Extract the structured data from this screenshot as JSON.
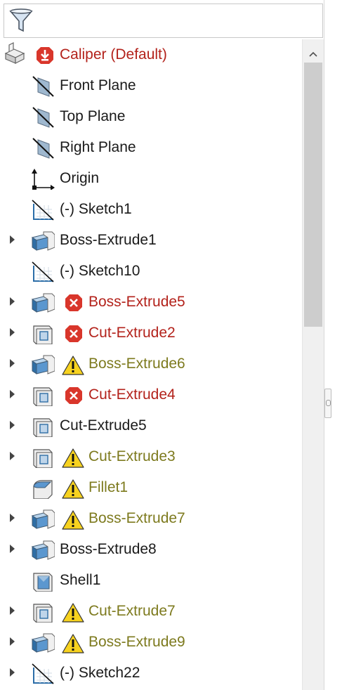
{
  "filter": {
    "icon": "filter-icon"
  },
  "root": {
    "label": "Caliper  (Default)",
    "icon": "part-icon",
    "status_icon": "rebuild-error-icon"
  },
  "items": [
    {
      "label": "Front Plane",
      "icon": "plane-icon",
      "expandable": false,
      "status": ""
    },
    {
      "label": "Top Plane",
      "icon": "plane-icon",
      "expandable": false,
      "status": ""
    },
    {
      "label": "Right Plane",
      "icon": "plane-icon",
      "expandable": false,
      "status": ""
    },
    {
      "label": "Origin",
      "icon": "origin-icon",
      "expandable": false,
      "status": ""
    },
    {
      "label": "(-) Sketch1",
      "icon": "sketch-icon",
      "expandable": false,
      "status": ""
    },
    {
      "label": "Boss-Extrude1",
      "icon": "boss-extrude-icon",
      "expandable": true,
      "status": ""
    },
    {
      "label": "(-) Sketch10",
      "icon": "sketch-icon",
      "expandable": false,
      "status": ""
    },
    {
      "label": "Boss-Extrude5",
      "icon": "boss-extrude-icon",
      "expandable": true,
      "status": "error"
    },
    {
      "label": "Cut-Extrude2",
      "icon": "cut-extrude-icon",
      "expandable": true,
      "status": "error"
    },
    {
      "label": "Boss-Extrude6",
      "icon": "boss-extrude-icon",
      "expandable": true,
      "status": "warning"
    },
    {
      "label": "Cut-Extrude4",
      "icon": "cut-extrude-icon",
      "expandable": true,
      "status": "error"
    },
    {
      "label": "Cut-Extrude5",
      "icon": "cut-extrude-icon",
      "expandable": true,
      "status": ""
    },
    {
      "label": "Cut-Extrude3",
      "icon": "cut-extrude-icon",
      "expandable": true,
      "status": "warning"
    },
    {
      "label": "Fillet1",
      "icon": "fillet-icon",
      "expandable": false,
      "status": "warning"
    },
    {
      "label": "Boss-Extrude7",
      "icon": "boss-extrude-icon",
      "expandable": true,
      "status": "warning"
    },
    {
      "label": "Boss-Extrude8",
      "icon": "boss-extrude-icon",
      "expandable": true,
      "status": ""
    },
    {
      "label": "Shell1",
      "icon": "shell-icon",
      "expandable": false,
      "status": ""
    },
    {
      "label": "Cut-Extrude7",
      "icon": "cut-extrude-icon",
      "expandable": true,
      "status": "warning"
    },
    {
      "label": "Boss-Extrude9",
      "icon": "boss-extrude-icon",
      "expandable": true,
      "status": "warning"
    },
    {
      "label": "(-) Sketch22",
      "icon": "sketch-icon",
      "expandable": true,
      "status": ""
    }
  ],
  "colors": {
    "error_text": "#b3221b",
    "warning_text": "#7d7a1e",
    "error_badge": "#d9362b",
    "warning_badge": "#f7d21f"
  }
}
